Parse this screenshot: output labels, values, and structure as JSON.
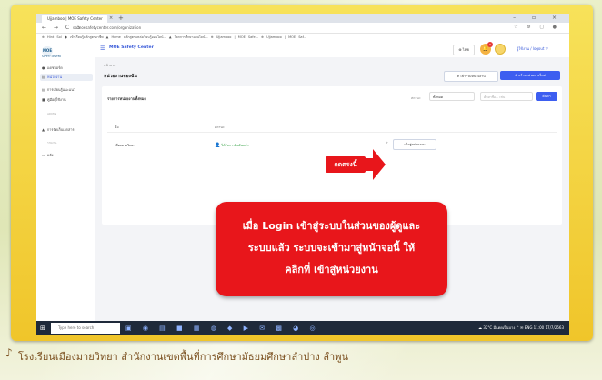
{
  "browser": {
    "tab_title": "Ujjamboo | MOE Safety Center",
    "tab_close": "×",
    "new_tab": "+",
    "window_controls": "– ▫ ×",
    "nav_icons": "← → C ⌂",
    "url": "ss.moesafetycenter.com/organization",
    "toolbar_icons": "☆ ⚙ ▢ ●",
    "bookmarks": "⊕ Hint Sol   ● เข้าเรียนรู้หลักสูตรอาชีพ   ▲ Home   หลักสูตรแหล่งเรียนรู้ออนไลน์...   ▲ โลกการศึกษาออนไลน์...   ⊕ Ujjamboo | MOE Safe...   ⊕ Ujjamboo | MOE Saf..."
  },
  "sidebar": {
    "logo": "MOE",
    "logo_sub": "SAFETY CENTER",
    "items": [
      {
        "icon": "●",
        "label": "แดชบอร์ด"
      },
      {
        "icon": "▤",
        "label": "หน่วยงาน",
        "active": true
      },
      {
        "icon": "▤",
        "label": "การเรียนรู้แนะแนว"
      },
      {
        "icon": "■",
        "label": "คู่มือผู้ใช้งาน"
      },
      {
        "icon": "",
        "label": "ADMIN"
      },
      {
        "icon": "▲",
        "label": "การจัดเก็บเอกสาร"
      },
      {
        "icon": "",
        "label": "รายงาน"
      },
      {
        "icon": "⇔",
        "label": "แจ้ง"
      }
    ]
  },
  "header": {
    "menu_icon": "☰",
    "app_title": "MOE Safety Center",
    "language": "⊕ ไทย",
    "bell": "🔔",
    "notification_count": "9",
    "username": "ผู้ใช้งาน / logout ▽"
  },
  "content": {
    "breadcrumb": "หน้าแรก",
    "page_title": "หน่วยงานของฉัน",
    "btn_join": "⊕ เข้าร่วมหน่วยงาน",
    "btn_create": "⊕ สร้างหน่วยงานใหม่",
    "panel_title": "รายการหน่วยงานทั้งหมด",
    "filter_label": "สถานะ",
    "filter_value": "ทั้งหมด",
    "search_placeholder": "ค้นหาชื่อ... เช่น",
    "search_button": "ค้นหา",
    "columns": [
      "ชื่อ",
      "สถานะ"
    ],
    "row": {
      "name": "เมืองมายวิทยา",
      "status_icon": "👤",
      "status": "ได้รับการยืนยันแล้ว",
      "chevron": "›",
      "enter_label": "เข้าสู่หน่วยงาน"
    }
  },
  "annotation": {
    "press_here": "กดตรงนี้",
    "callout_lines": [
      "เมื่อ Login เข้าสู่ระบบในส่วนของผู้ดูและ",
      "ระบบแล้ว ระบบจะเข้ามาสู่หน้าจอนี้ ให้",
      "คลิกที่ เข้าสู่หน่วยงาน"
    ],
    "accent_color": "#e8161b"
  },
  "taskbar": {
    "start_icon": "⊞",
    "search_placeholder": "Type here to search",
    "app_icons": "▣ ◉ ▤ ■ ▦ ◍ ◆ ▶ ✉ ▩ ◕ ◎",
    "tray": "☁ 32°C มีแดดเป็นบาง  ^ ✉ ENG  11:00  17/7/2563"
  },
  "footer": {
    "icon": "♪",
    "text": "โรงเรียนเมืองมายวิทยา  สำนักงานเขตพื้นที่การศึกษามัธยมศึกษาลำปาง  ลำพูน"
  }
}
